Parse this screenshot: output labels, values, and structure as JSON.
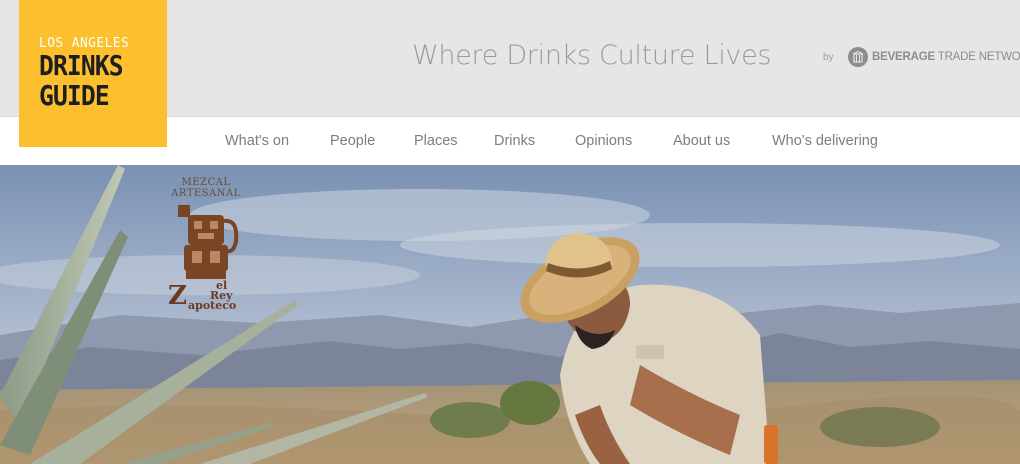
{
  "site": {
    "logo": {
      "line1": "LOS ANGELES",
      "line2": "DRINKS",
      "line3": "GUIDE"
    },
    "tagline": "Where Drinks Culture Lives",
    "partner": {
      "by_label": "by",
      "name_bold": "BEVERAGE",
      "name_rest": " TRADE NETWORK",
      "icon": "building-icon"
    }
  },
  "nav": {
    "items": [
      {
        "label": "What's on"
      },
      {
        "label": "People"
      },
      {
        "label": "Places"
      },
      {
        "label": "Drinks"
      },
      {
        "label": "Opinions"
      },
      {
        "label": "About us"
      },
      {
        "label": "Who's delivering"
      }
    ]
  },
  "hero": {
    "brand": {
      "line1": "MEZCAL",
      "line2": "ARTESANAL",
      "name_initial": "Z",
      "name_part1": "el",
      "name_part2": "Rey",
      "name_part3": "apoteco"
    },
    "colors": {
      "sky_top": "#7d93b4",
      "sky_bottom": "#c9d3e2",
      "mountains": "#7f8aa0",
      "field": "#b9a27a"
    }
  },
  "theme": {
    "logo_bg": "#fcc02e",
    "header_bg": "#e6e6e6",
    "nav_text": "#7d7d7d"
  }
}
